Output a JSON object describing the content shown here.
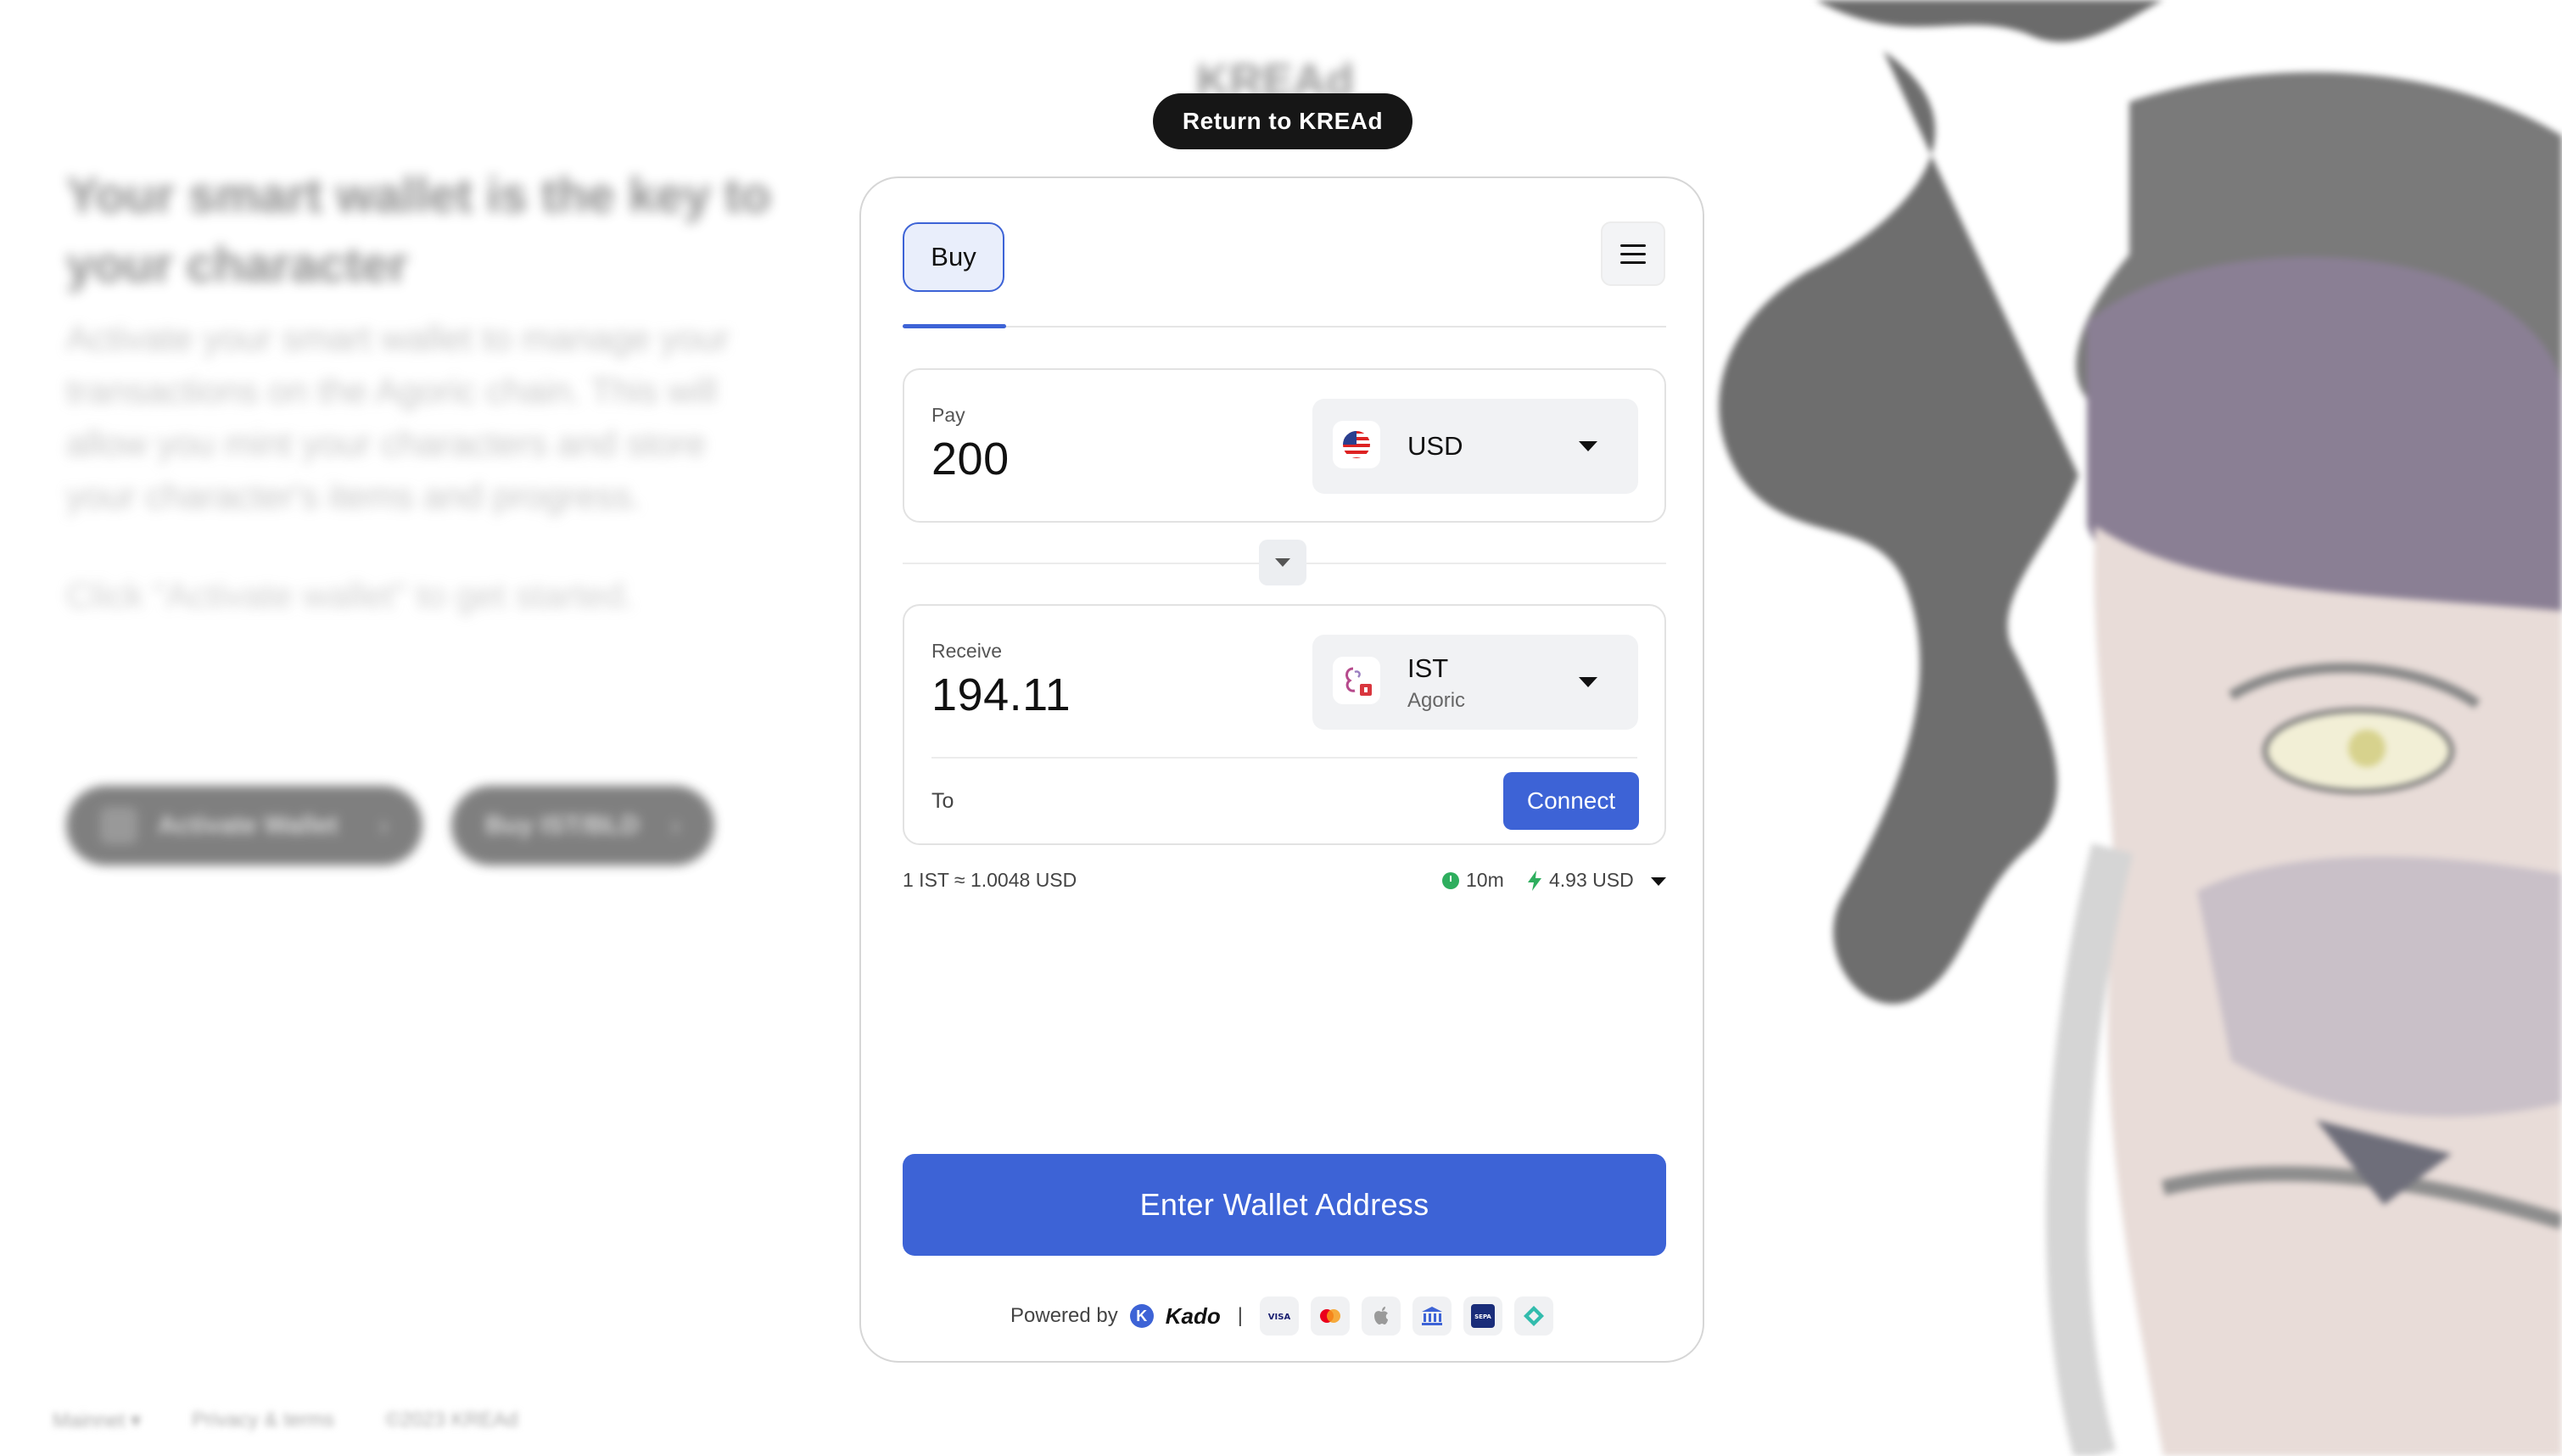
{
  "background": {
    "logo": "KREAd",
    "heading": "Your smart wallet is the key to your character",
    "paragraph": "Activate your smart wallet to manage your transactions on the Agoric chain. This will allow you mint your characters and store your character's items and progress.",
    "cta_text": "Click \"Activate wallet\" to get started.",
    "activate_button_label": "Activate Wallet",
    "buy_button_label": "Buy IST/BLD",
    "footer": {
      "network_label": "Mainnet",
      "links": [
        "Privacy & terms",
        "©2023 KREAd"
      ]
    }
  },
  "return_button": {
    "label": "Return to KREAd"
  },
  "widget": {
    "tab": {
      "label": "Buy"
    },
    "menu_icon": "hamburger-menu-icon",
    "pay": {
      "label": "Pay",
      "amount": "200",
      "currency": "USD",
      "currency_icon": "us-flag-icon"
    },
    "swap_icon": "chevron-down-icon",
    "receive": {
      "label": "Receive",
      "amount": "194.11",
      "currency": "IST",
      "network": "Agoric",
      "currency_icon": "ist-token-icon"
    },
    "to": {
      "label": "To",
      "connect_label": "Connect"
    },
    "quote": {
      "rate": "1 IST ≈ 1.0048 USD",
      "eta": "10m",
      "fee": "4.93 USD"
    },
    "primary_button_label": "Enter Wallet Address",
    "footer": {
      "powered_by": "Powered by",
      "brand": "Kado",
      "separator": "|",
      "payment_methods": [
        "visa-icon",
        "mastercard-icon",
        "apple-pay-icon",
        "bank-icon",
        "sepa-icon",
        "pix-icon"
      ]
    }
  },
  "colors": {
    "accent": "#3d63d6",
    "dark_pill": "#161616",
    "clock_green": "#2eae5e"
  }
}
